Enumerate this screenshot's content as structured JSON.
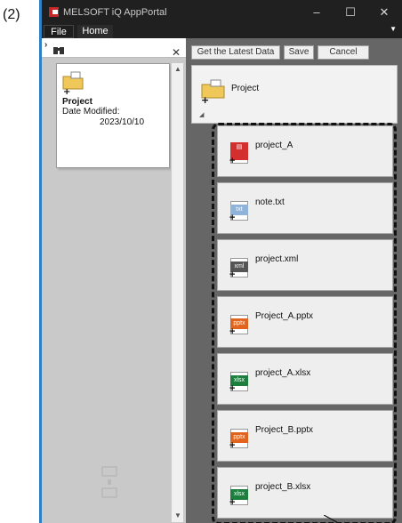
{
  "step_label": "(2)",
  "titlebar": {
    "title": "MELSOFT iQ AppPortal",
    "minimize": "–",
    "maximize": "☐",
    "close": "✕"
  },
  "menu": {
    "file": "File",
    "home": "Home"
  },
  "left_panel": {
    "search_value": "",
    "close_glyph": "✕",
    "card": {
      "name": "Project",
      "date_label": "Date Modified:",
      "date_value": "2023/10/10"
    }
  },
  "toolbar": {
    "get_latest": "Get the Latest Data",
    "save": "Save",
    "cancel": "Cancel"
  },
  "project_node": {
    "label": "Project"
  },
  "files": [
    {
      "name": "project_A",
      "type": "project",
      "color": "#d32f2f"
    },
    {
      "name": "note.txt",
      "type": "txt",
      "color": "#8fb3d9"
    },
    {
      "name": "project.xml",
      "type": "xml",
      "color": "#555555"
    },
    {
      "name": "Project_A.pptx",
      "type": "pptx",
      "color": "#e0641d"
    },
    {
      "name": "project_A.xlsx",
      "type": "xlsx",
      "color": "#1e7e3e"
    },
    {
      "name": "Project_B.pptx",
      "type": "pptx",
      "color": "#e0641d"
    },
    {
      "name": "project_B.xlsx",
      "type": "xlsx",
      "color": "#1e7e3e"
    }
  ]
}
